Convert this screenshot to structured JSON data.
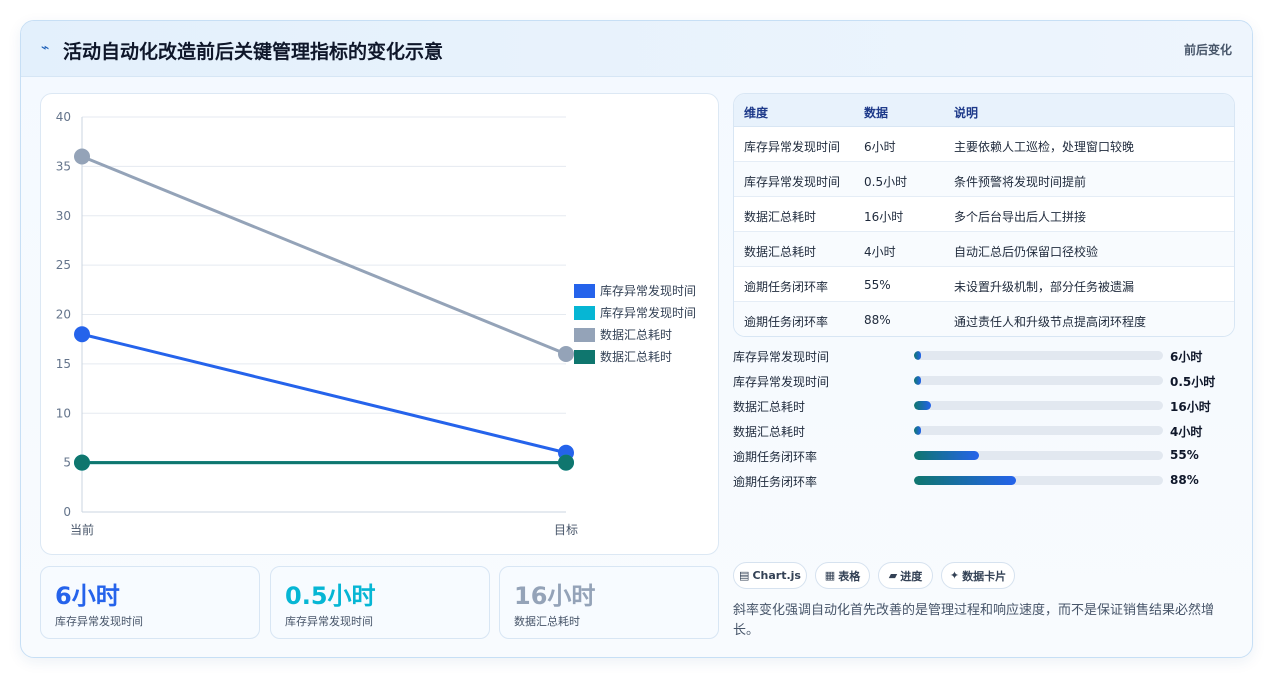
{
  "header": {
    "icon": "lightning-icon",
    "title": "活动自动化改造前后关键管理指标的变化示意",
    "tag": "前后变化"
  },
  "chart_data": {
    "type": "line",
    "categories": [
      "当前",
      "目标"
    ],
    "ylim": [
      0,
      40
    ],
    "yticks": [
      0,
      5,
      10,
      15,
      20,
      25,
      30,
      35,
      40
    ],
    "legend_position": "right",
    "series": [
      {
        "name": "库存异常发现时间",
        "color": "#2563eb",
        "values": [
          18,
          6
        ]
      },
      {
        "name": "库存异常发现时间",
        "color": "#06b6d4",
        "values": [
          5,
          5
        ]
      },
      {
        "name": "数据汇总耗时",
        "color": "#94a3b8",
        "values": [
          36,
          16
        ]
      },
      {
        "name": "数据汇总耗时",
        "color": "#0f766e",
        "values": [
          5,
          5
        ]
      }
    ]
  },
  "stats": [
    {
      "value": "6小时",
      "label": "库存异常发现时间",
      "color": "#2563eb"
    },
    {
      "value": "0.5小时",
      "label": "库存异常发现时间",
      "color": "#06b6d4"
    },
    {
      "value": "16小时",
      "label": "数据汇总耗时",
      "color": "#94a3b8"
    }
  ],
  "table": {
    "headers": [
      "维度",
      "数据",
      "说明"
    ],
    "rows": [
      [
        "库存异常发现时间",
        "6小时",
        "主要依赖人工巡检，处理窗口较晚"
      ],
      [
        "库存异常发现时间",
        "0.5小时",
        "条件预警将发现时间提前"
      ],
      [
        "数据汇总耗时",
        "16小时",
        "多个后台导出后人工拼接"
      ],
      [
        "数据汇总耗时",
        "4小时",
        "自动汇总后仍保留口径校验"
      ],
      [
        "逾期任务闭环率",
        "55%",
        "未设置升级机制，部分任务被遗漏"
      ],
      [
        "逾期任务闭环率",
        "88%",
        "通过责任人和升级节点提高闭环程度"
      ]
    ]
  },
  "progress": [
    {
      "label": "库存异常发现时间",
      "value": "6小时",
      "fraction": 0.03
    },
    {
      "label": "库存异常发现时间",
      "value": "0.5小时",
      "fraction": 0.03
    },
    {
      "label": "数据汇总耗时",
      "value": "16小时",
      "fraction": 0.07
    },
    {
      "label": "数据汇总耗时",
      "value": "4小时",
      "fraction": 0.03
    },
    {
      "label": "逾期任务闭环率",
      "value": "55%",
      "fraction": 0.26
    },
    {
      "label": "逾期任务闭环率",
      "value": "88%",
      "fraction": 0.41
    }
  ],
  "chips": [
    {
      "icon": "chart-icon",
      "glyph": "▤",
      "label": "Chart.js"
    },
    {
      "icon": "table-icon",
      "glyph": "▦",
      "label": "表格"
    },
    {
      "icon": "progress-icon",
      "glyph": "▰",
      "label": "进度"
    },
    {
      "icon": "sparkle-icon",
      "glyph": "✦",
      "label": "数据卡片"
    }
  ],
  "note": "斜率变化强调自动化首先改善的是管理过程和响应速度，而不是保证销售结果必然增长。"
}
